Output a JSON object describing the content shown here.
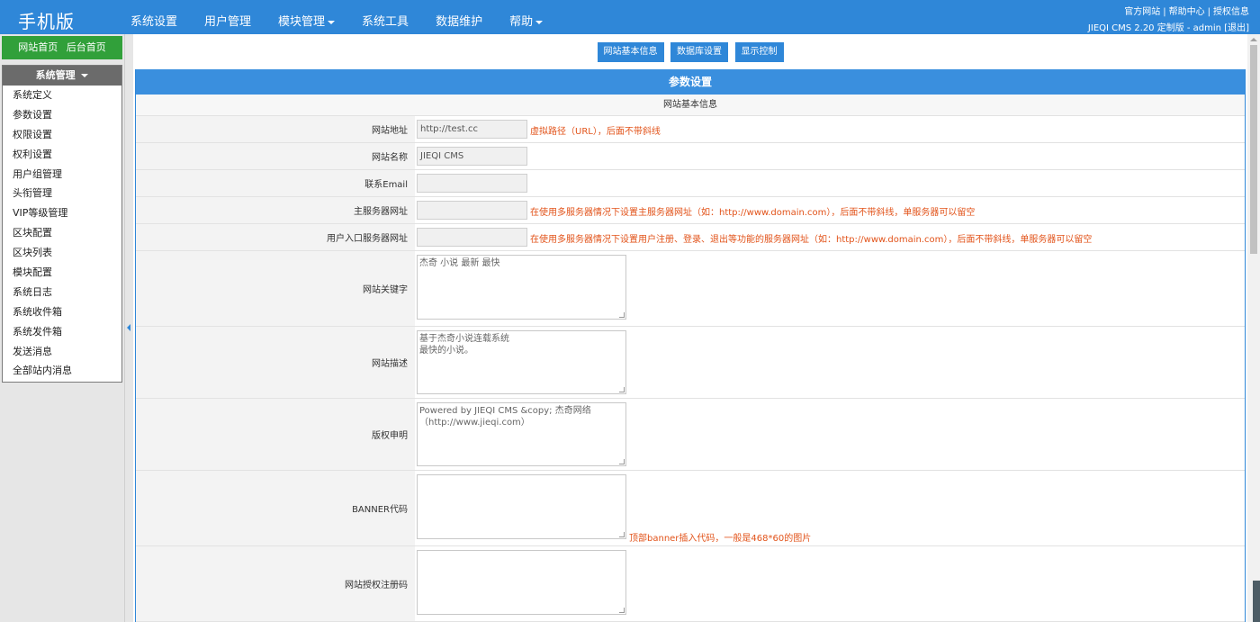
{
  "header": {
    "brand": "手机版",
    "nav": [
      {
        "label": "系统设置",
        "dropdown": false
      },
      {
        "label": "用户管理",
        "dropdown": false
      },
      {
        "label": "模块管理",
        "dropdown": true
      },
      {
        "label": "系统工具",
        "dropdown": false
      },
      {
        "label": "数据维护",
        "dropdown": false
      },
      {
        "label": "帮助",
        "dropdown": true
      }
    ],
    "links": [
      "官方网站",
      "帮助中心",
      "授权信息"
    ],
    "link_separator": "|",
    "version_info": "JIEQI CMS 2.20 定制版 - admin [退出]"
  },
  "sidebar": {
    "home_links": [
      "网站首页",
      "后台首页"
    ],
    "menu_title": "系统管理",
    "items": [
      "系统定义",
      "参数设置",
      "权限设置",
      "权利设置",
      "用户组管理",
      "头衔管理",
      "VIP等级管理",
      "区块配置",
      "区块列表",
      "模块配置",
      "系统日志",
      "系统收件箱",
      "系统发件箱",
      "发送消息",
      "全部站内消息"
    ]
  },
  "tabs": [
    "网站基本信息",
    "数据库设置",
    "显示控制"
  ],
  "panel": {
    "title": "参数设置",
    "section": "网站基本信息"
  },
  "form": {
    "site_url": {
      "label": "网站地址",
      "value": "http://test.cc",
      "hint": "虚拟路径（URL），后面不带斜线"
    },
    "site_name": {
      "label": "网站名称",
      "value": "JIEQI CMS"
    },
    "email": {
      "label": "联系Email",
      "value": ""
    },
    "main_server": {
      "label": "主服务器网址",
      "value": "",
      "hint": "在使用多服务器情况下设置主服务器网址（如：http://www.domain.com），后面不带斜线，单服务器可以留空"
    },
    "user_server": {
      "label": "用户入口服务器网址",
      "value": "",
      "hint": "在使用多服务器情况下设置用户注册、登录、退出等功能的服务器网址（如：http://www.domain.com），后面不带斜线，单服务器可以留空"
    },
    "keywords": {
      "label": "网站关键字",
      "value": "杰奇 小说 最新 最快"
    },
    "description": {
      "label": "网站描述",
      "value": "基于杰奇小说连载系统\n最快的小说。"
    },
    "copyright": {
      "label": "版权申明",
      "value": "Powered by JIEQI CMS &copy; 杰奇网络（http://www.jieqi.com）"
    },
    "banner": {
      "label": "BANNER代码",
      "value": "",
      "hint": "顶部banner插入代码，一般是468*60的图片"
    },
    "license": {
      "label": "网站授权注册码",
      "value": ""
    }
  },
  "colors": {
    "primary": "#2f87d8",
    "green": "#31a03a",
    "hint": "#e2531a"
  }
}
